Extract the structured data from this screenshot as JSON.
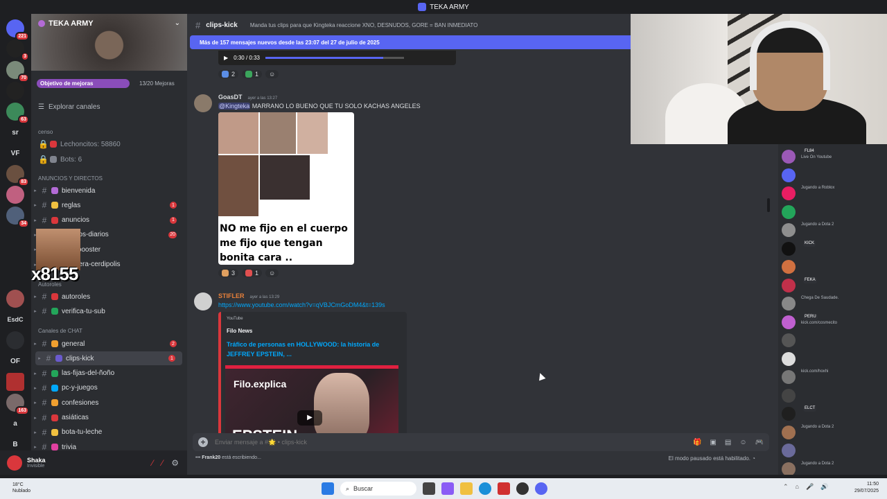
{
  "window_title": "TEKA ARMY",
  "server": {
    "name": "TEKA ARMY",
    "boost_goal_label": "Objetivo de mejoras",
    "boost_progress": "13/20 Mejoras",
    "explore_label": "Explorar canales",
    "overlay_text": "x8155"
  },
  "rail": {
    "badges": [
      "221",
      "3",
      "70",
      "63",
      "83",
      "34",
      "163"
    ],
    "text_icons": [
      "sr",
      "VF",
      "EsdC",
      "OF",
      "a",
      "B"
    ]
  },
  "categories": {
    "censo": "censo",
    "anuncios": "ANUNCIOS Y DIRECTOS",
    "autoroles": "Autoroles",
    "chat": "Canales de CHAT"
  },
  "stats": {
    "lechoncitos": "Lechoncitos: 58860",
    "bots": "Bots: 6"
  },
  "channels_anuncios": [
    {
      "label": "bienvenida",
      "ping": ""
    },
    {
      "label": "reglas",
      "ping": "1"
    },
    {
      "label": "anuncios",
      "ping": "1"
    },
    {
      "label": "directos-diarios",
      "ping": "20"
    },
    {
      "label": "nitro-booster",
      "ping": ""
    },
    {
      "label": "cartelera-cerdipolis",
      "ping": ""
    }
  ],
  "channels_autoroles": [
    {
      "label": "autoroles",
      "ping": ""
    },
    {
      "label": "verifica-tu-sub",
      "ping": ""
    }
  ],
  "channels_chat": [
    {
      "label": "general",
      "ping": "2"
    },
    {
      "label": "clips-kick",
      "ping": "1"
    },
    {
      "label": "las-fijas-del-ñoño",
      "ping": ""
    },
    {
      "label": "pc-y-juegos",
      "ping": ""
    },
    {
      "label": "confesiones",
      "ping": ""
    },
    {
      "label": "asiáticas",
      "ping": ""
    },
    {
      "label": "bota-tu-leche",
      "ping": ""
    },
    {
      "label": "trivia",
      "ping": ""
    }
  ],
  "user": {
    "name": "Shaka",
    "status": "Invisible"
  },
  "channel": {
    "name": "clips-kick",
    "topic": "Manda tus clips para que Kingteka reaccione XNO, DESNUDOS, GORE = BAN INMEDIATO",
    "new_messages_bar": "Más de 157 mensajes nuevos desde las 23:07 del 27 de julio de 2025",
    "video_time": "0:30 / 0:33"
  },
  "messages": [
    {
      "reactions": [
        {
          "count": "2"
        },
        {
          "count": "1"
        }
      ]
    },
    {
      "author": "GoasDT",
      "time": "ayer a las 13:27",
      "mention": "@Kingteka",
      "text": "MARRANO LO BUENO QUE TU SOLO KACHAS ANGELES",
      "meme_caption": [
        "NO me fijo en el cuerpo",
        "me fijo que tengan",
        "bonita cara .."
      ],
      "reactions": [
        {
          "count": "3"
        },
        {
          "count": "1"
        }
      ]
    },
    {
      "author": "STIFLER",
      "time": "ayer a las 13:29",
      "link": "https://www.youtube.com/watch?v=qVBJCmGoDM4&t=139s",
      "embed": {
        "provider": "YouTube",
        "author": "Filo News",
        "title": "Tráfico de personas en HOLLYWOOD: la historia de JEFFREY EPSTEIN, ...",
        "thumb_brand": "Filo.explica",
        "thumb_big": "EPSTEIN"
      }
    }
  ],
  "composer": {
    "placeholder": "Enviar mensaje a #🌟 • clips-kick",
    "typing_user": "Frank20",
    "typing_suffix": " está escribiendo...",
    "paused": "El modo pausado está habilitado."
  },
  "members": [
    {
      "name": "",
      "activity": "Live On Youtube",
      "tag": "FL84",
      "color": "#9b59b6"
    },
    {
      "name": "",
      "activity": "",
      "tag": "",
      "color": "#5865f2"
    },
    {
      "name": "",
      "activity": "Jugando a Roblox",
      "tag": "",
      "color": "#e91e63"
    },
    {
      "name": "",
      "activity": "",
      "tag": "",
      "color": "#23a55a"
    },
    {
      "name": "",
      "activity": "Jugando a Dota 2",
      "tag": "",
      "color": "#8e8e8e"
    },
    {
      "name": "",
      "activity": "",
      "tag": "KICK",
      "color": "#111111"
    },
    {
      "name": "",
      "activity": "",
      "tag": "",
      "color": "#d07040"
    },
    {
      "name": "",
      "activity": "",
      "tag": "FEKA",
      "color": "#c0304a"
    },
    {
      "name": "",
      "activity": "Chega De Saudade.",
      "tag": "",
      "color": "#888888"
    },
    {
      "name": "",
      "activity": "kick.com/cosmecito",
      "tag": "PERU",
      "color": "#c060d0"
    },
    {
      "name": "",
      "activity": "",
      "tag": "",
      "color": "#555555"
    },
    {
      "name": "",
      "activity": "",
      "tag": "",
      "color": "#dddddd"
    },
    {
      "name": "",
      "activity": "kick.com/hoxhi",
      "tag": "",
      "color": "#777777"
    },
    {
      "name": "",
      "activity": "",
      "tag": "",
      "color": "#444444"
    },
    {
      "name": "",
      "activity": "",
      "tag": "ELCT",
      "color": "#1f1f1f"
    },
    {
      "name": "",
      "activity": "Jugando a Dota 2",
      "tag": "",
      "color": "#a07050"
    },
    {
      "name": "",
      "activity": "",
      "tag": "",
      "color": "#6a6a9a"
    },
    {
      "name": "",
      "activity": "Jugando a Dota 2",
      "tag": "",
      "color": "#8a7060"
    }
  ],
  "taskbar": {
    "temp": "18°C",
    "weather": "Nublado",
    "search": "Buscar",
    "time": "11:50",
    "date": "29/07/2025"
  }
}
